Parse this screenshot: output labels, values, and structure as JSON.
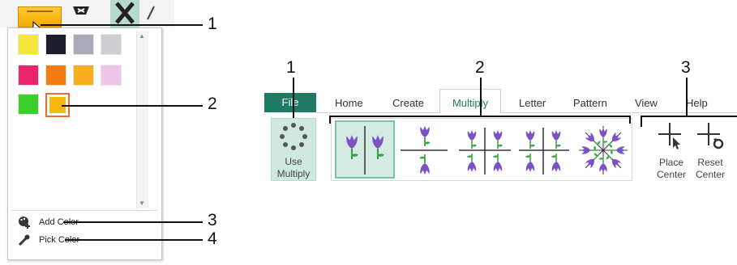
{
  "colors": {
    "accent": "#1e7a63",
    "selected_border": "#e8702a",
    "swatches": [
      "#f5e63a",
      "#1c1f2b",
      "#a9aab8",
      "#cfcfd3",
      "#e8246a",
      "#f57c12",
      "#f8ad1c",
      "#efc6ea",
      "#3ccf2c",
      "#f7b90a"
    ]
  },
  "color_panel": {
    "add_color_label": "Add Color",
    "pick_color_label": "Pick Color"
  },
  "ribbon": {
    "tabs": [
      "File",
      "Home",
      "Create",
      "Multiply",
      "Letter",
      "Pattern",
      "View",
      "Help"
    ],
    "use_multiply_label_1": "Use",
    "use_multiply_label_2": "Multiply",
    "place_center_1": "Place",
    "place_center_2": "Center",
    "reset_center_1": "Reset",
    "reset_center_2": "Center"
  },
  "callouts": {
    "left": [
      "1",
      "2",
      "3",
      "4"
    ],
    "right": [
      "1",
      "2",
      "3"
    ]
  }
}
